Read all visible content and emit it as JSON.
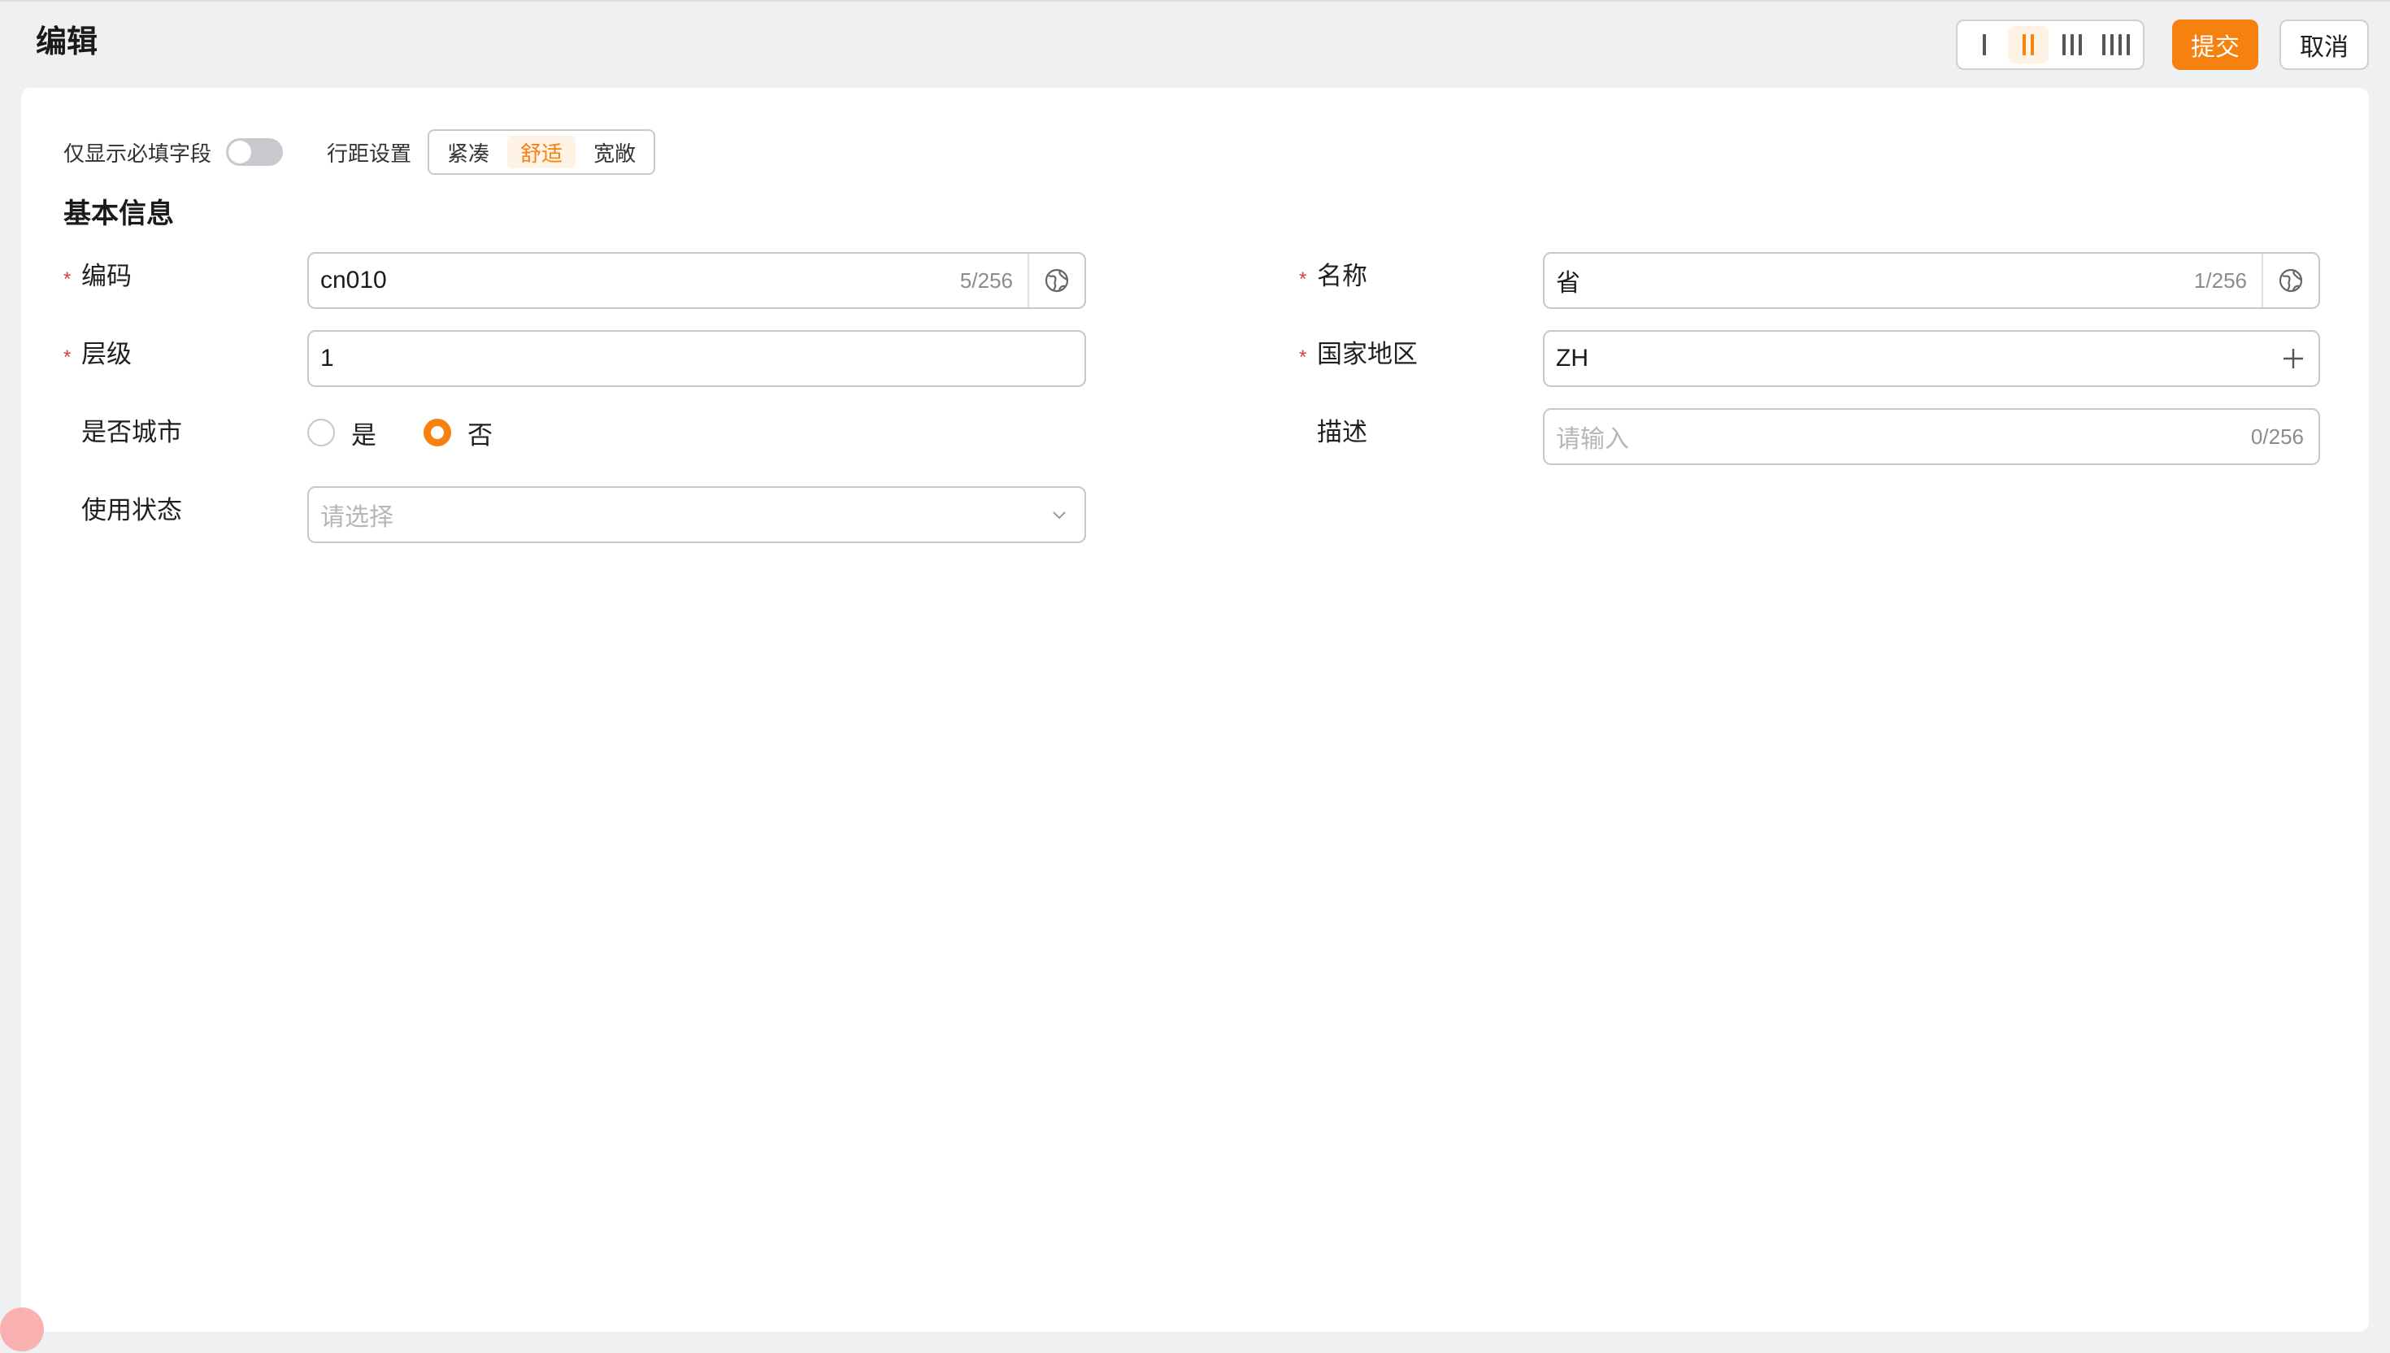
{
  "page": {
    "title": "编辑"
  },
  "header": {
    "column_options": [
      {
        "bars": 1,
        "active": false
      },
      {
        "bars": 2,
        "active": true
      },
      {
        "bars": 3,
        "active": false
      },
      {
        "bars": 4,
        "active": false
      }
    ],
    "submit_label": "提交",
    "cancel_label": "取消"
  },
  "toolbar": {
    "required_only_label": "仅显示必填字段",
    "required_only_on": false,
    "spacing_label": "行距设置",
    "spacing_options": [
      "紧凑",
      "舒适",
      "宽敞"
    ],
    "spacing_selected": "舒适"
  },
  "section": {
    "title": "基本信息"
  },
  "fields": {
    "code": {
      "label": "编码",
      "required": true,
      "value": "cn010",
      "count": "5/256"
    },
    "name": {
      "label": "名称",
      "required": true,
      "value": "省",
      "count": "1/256"
    },
    "level": {
      "label": "层级",
      "required": true,
      "value": "1"
    },
    "country": {
      "label": "国家地区",
      "required": true,
      "value": "ZH"
    },
    "is_city": {
      "label": "是否城市",
      "options": [
        "是",
        "否"
      ],
      "selected": "否"
    },
    "description": {
      "label": "描述",
      "placeholder": "请输入",
      "count": "0/256"
    },
    "status": {
      "label": "使用状态",
      "placeholder": "请选择"
    }
  },
  "colors": {
    "accent": "#f7810f",
    "required": "#e23b3b",
    "background": "#eff0f2"
  },
  "icons": {
    "translate": "globe-icon",
    "add": "plus-icon",
    "dropdown": "chevron-down-icon"
  }
}
